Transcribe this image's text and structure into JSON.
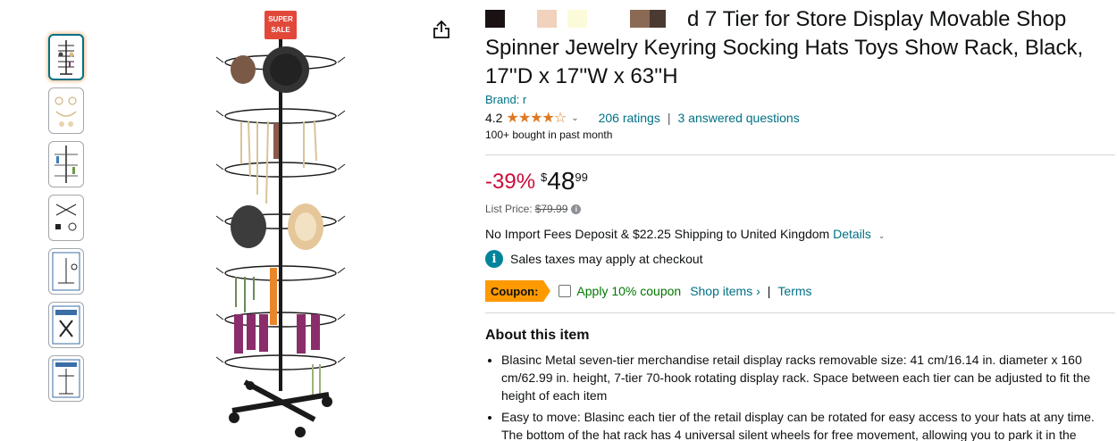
{
  "product": {
    "title_visible": "d 7 Tier for Store Display Movable Shop Spinner Jewelry Keyring Socking Hats Toys Show Rack, Black, 17''D x 17''W x 63''H",
    "brand_label": "Brand: r",
    "rating_value": "4.2",
    "stars": "★★★★☆",
    "ratings_count": "206 ratings",
    "answered_questions": "3 answered questions",
    "bought": "100+ bought in past month",
    "main_image_sign": "SUPER SALE"
  },
  "price": {
    "discount": "-39%",
    "currency": "$",
    "whole": "48",
    "fraction": "99",
    "list_label": "List Price:",
    "list_value": "$79.99"
  },
  "shipping": {
    "text": "No Import Fees Deposit & $22.25 Shipping to United Kingdom",
    "details": "Details"
  },
  "tax": {
    "text": "Sales taxes may apply at checkout"
  },
  "coupon": {
    "badge": "Coupon:",
    "apply": "Apply 10% coupon",
    "shop_items": "Shop items ›",
    "terms": "Terms"
  },
  "about": {
    "heading": "About this item",
    "bullets": [
      "Blasinc Metal seven-tier merchandise retail display racks removable size: 41 cm/16.14 in. diameter x 160 cm/62.99 in. height, 7-tier 70-hook rotating display rack. Space between each tier can be adjusted to fit the height of each item",
      "Easy to move: Blasinc each tier of the retail display can be rotated for easy access to your hats at any time. The bottom of the hat rack has 4 universal silent wheels for free movement, allowing you to park it in the"
    ]
  },
  "colors": {
    "link": "#007185",
    "discount": "#cc0c39",
    "coupon_badge": "#ff9900",
    "coupon_text": "#007600",
    "star": "#de7921"
  }
}
